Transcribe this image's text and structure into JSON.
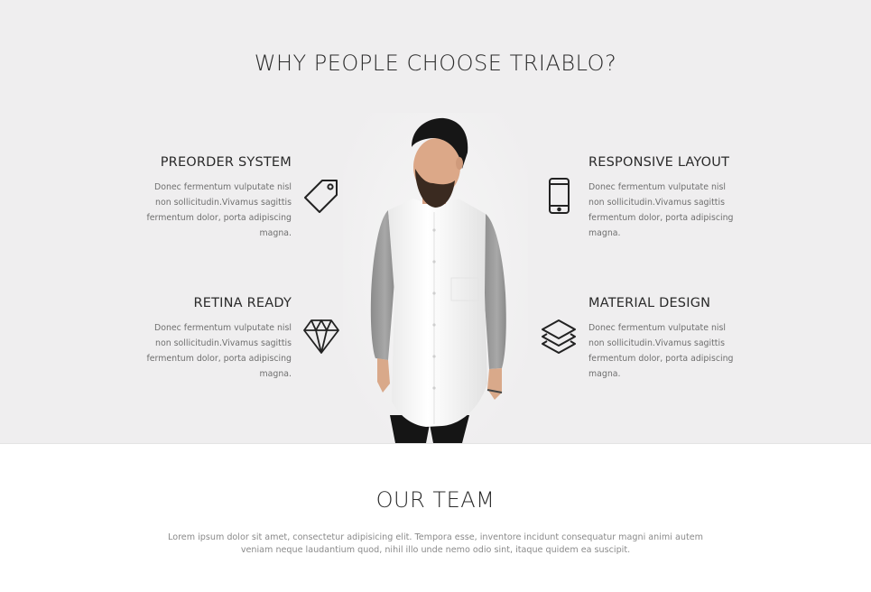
{
  "why": {
    "title": "WHY PEOPLE CHOOSE TRIABLO?",
    "features": [
      {
        "title": "PREORDER SYSTEM",
        "text": "Donec fermentum vulputate nisl non sollicitudin.Vivamus sagittis fermentum dolor, porta adipiscing magna.",
        "icon": "price-tag-icon"
      },
      {
        "title": "RESPONSIVE LAYOUT",
        "text": "Donec fermentum vulputate nisl non sollicitudin.Vivamus sagittis fermentum dolor, porta adipiscing magna.",
        "icon": "smartphone-icon"
      },
      {
        "title": "RETINA READY",
        "text": "Donec fermentum vulputate nisl non sollicitudin.Vivamus sagittis fermentum dolor, porta adipiscing magna.",
        "icon": "diamond-icon"
      },
      {
        "title": "MATERIAL DESIGN",
        "text": "Donec fermentum vulputate nisl non sollicitudin.Vivamus sagittis fermentum dolor, porta adipiscing magna.",
        "icon": "layers-icon"
      }
    ]
  },
  "team": {
    "title": "OUR TEAM",
    "description": "Lorem ipsum dolor sit amet, consectetur adipisicing elit. Tempora esse, inventore incidunt consequatur magni animi autem veniam neque laudantium quod, nihil illo unde nemo odio sint, itaque quidem ea suscipit."
  },
  "colors": {
    "section_background": "#efeeef",
    "heading": "#2b2b2b",
    "body_text": "#6f6f6f"
  }
}
